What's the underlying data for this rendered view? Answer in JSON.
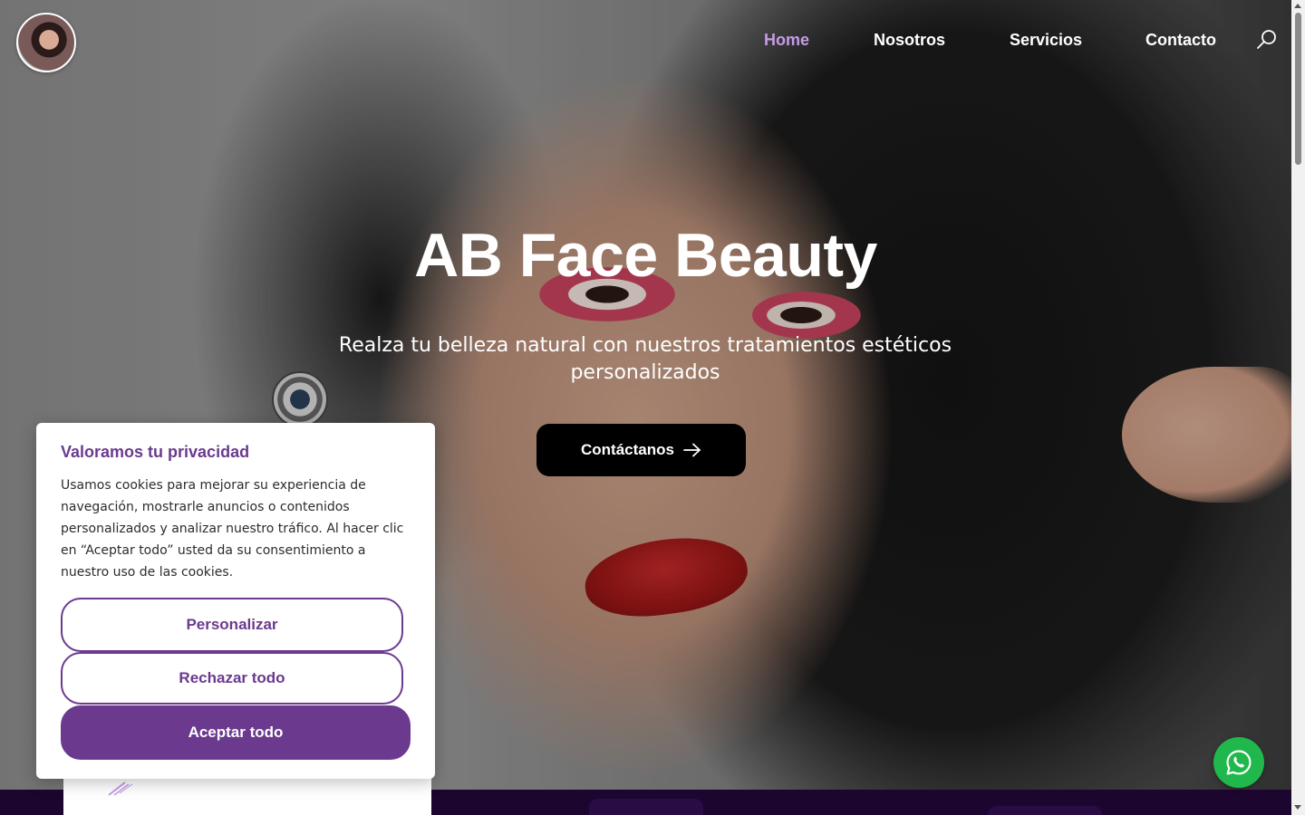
{
  "nav": {
    "items": [
      {
        "label": "Home",
        "active": true
      },
      {
        "label": "Nosotros",
        "active": false
      },
      {
        "label": "Servicios",
        "active": false
      },
      {
        "label": "Contacto",
        "active": false
      }
    ],
    "search_icon": "search-icon",
    "logo": "avatar-logo"
  },
  "hero": {
    "title": "AB Face Beauty",
    "subtitle": "Realza tu belleza natural con nuestros tratamientos estéticos personalizados",
    "cta_label": "Contáctanos",
    "cta_icon": "arrow-right-icon"
  },
  "cookie": {
    "title": "Valoramos tu privacidad",
    "text": "Usamos cookies para mejorar su experiencia de navegación, mostrarle anuncios o contenidos personalizados y analizar nuestro tráfico. Al hacer clic en “Aceptar todo” usted da su consentimiento a nuestro uso de las cookies.",
    "customize_label": "Personalizar",
    "reject_label": "Rechazar todo",
    "accept_label": "Aceptar todo"
  },
  "whatsapp": {
    "icon": "whatsapp-icon"
  },
  "colors": {
    "accent": "#6b3a8f",
    "nav_active": "#c79be8",
    "whatsapp": "#20b84c",
    "footer": "#1c0630"
  }
}
